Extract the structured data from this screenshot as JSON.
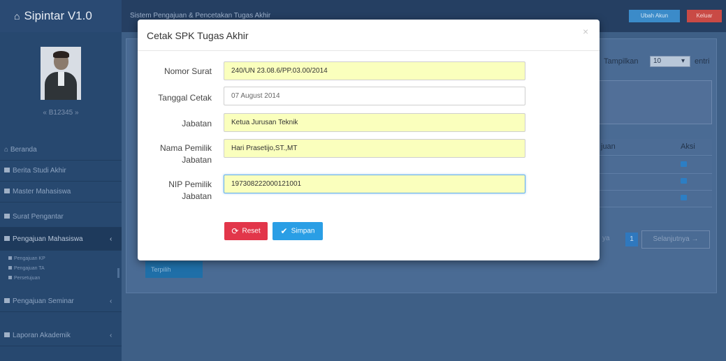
{
  "app": {
    "brand": "Sipintar V1.0",
    "home_icon": "home-icon",
    "breadcrumb": "Sistem Pengajuan & Pencetakan Tugas Akhir",
    "btn_ubah_akun": "Ubah Akun",
    "btn_keluar": "Keluar"
  },
  "sidebar": {
    "username": "« B12345 »",
    "items": [
      {
        "label": "Beranda"
      },
      {
        "label": "Berita Studi Akhir"
      },
      {
        "label": "Master Mahasiswa"
      },
      {
        "label": "Surat Pengantar"
      },
      {
        "label": "Pengajuan Mahasiswa",
        "chevron": "‹"
      },
      {
        "label": "Pengajuan Seminar",
        "chevron": "‹"
      },
      {
        "label": "Laporan Akademik",
        "chevron": "‹"
      }
    ],
    "subitems": [
      {
        "label": "Pengajuan KP"
      },
      {
        "label": "Pengajuan TA"
      },
      {
        "label": "Persetujuan"
      }
    ]
  },
  "background": {
    "show_label": "Tampilkan",
    "show_value": "10",
    "entries_label": "entri",
    "col_pengajuan": "juan",
    "col_aksi": "Aksi",
    "page_prev": "ya",
    "page_current": "1",
    "page_next": "Selanjutnya →",
    "btn_terpilih": "Terpilih"
  },
  "modal": {
    "title": "Cetak SPK Tugas Akhir",
    "close": "×",
    "fields": [
      {
        "label": "Nomor Surat",
        "value": "240/UN 23.08.6/PP.03.00/2014"
      },
      {
        "label": "Tanggal Cetak",
        "value": "07 August 2014"
      },
      {
        "label": "Jabatan",
        "value": "Ketua Jurusan Teknik"
      },
      {
        "label": "Nama Pemilik Jabatan",
        "value": "Hari Prasetijo,ST.,MT"
      },
      {
        "label": "NIP Pemilik Jabatan",
        "value": "197308222000121001"
      }
    ],
    "btn_reset": "Reset",
    "btn_simpan": "Simpan"
  },
  "colors": {
    "reset": "#e2364a",
    "simpan": "#2a9ee5",
    "autofill": "#faffbd"
  }
}
